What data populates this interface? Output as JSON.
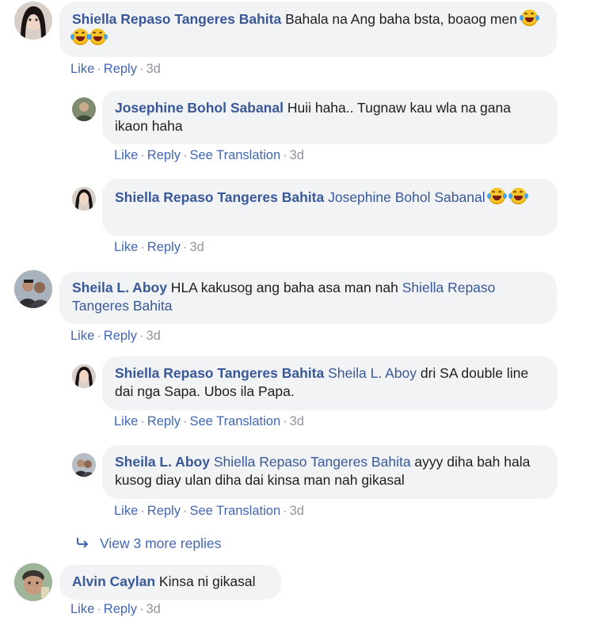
{
  "comments": [
    {
      "author": "Shiella Repaso Tangeres Bahita",
      "text": " Bahala na Ang baha bsta, boaog men",
      "emoji_count": 3,
      "actions": {
        "like": "Like",
        "reply": "Reply",
        "time": "3d"
      }
    },
    {
      "author": "Josephine Bohol Sabanal",
      "text": " Huii haha.. Tugnaw kau wla na gana ikaon haha",
      "actions": {
        "like": "Like",
        "reply": "Reply",
        "translate": "See Translation",
        "time": "3d"
      }
    },
    {
      "author": "Shiella Repaso Tangeres Bahita",
      "mention": "Josephine Bohol Sabanal",
      "emoji_count": 2,
      "actions": {
        "like": "Like",
        "reply": "Reply",
        "time": "3d"
      }
    },
    {
      "author": "Sheila L. Aboy",
      "text": " HLA kakusog ang baha asa man nah ",
      "mention": "Shiella Repaso Tangeres Bahita",
      "actions": {
        "like": "Like",
        "reply": "Reply",
        "time": "3d"
      }
    },
    {
      "author": "Shiella Repaso Tangeres Bahita",
      "mention": "Sheila L. Aboy",
      "text": " dri SA double line dai nga Sapa. Ubos ila Papa.",
      "actions": {
        "like": "Like",
        "reply": "Reply",
        "translate": "See Translation",
        "time": "3d"
      }
    },
    {
      "author": "Sheila L. Aboy",
      "mention": "Shiella Repaso Tangeres Bahita",
      "text": " ayyy diha bah hala kusog diay ulan diha dai kinsa man nah gikasal",
      "actions": {
        "like": "Like",
        "reply": "Reply",
        "translate": "See Translation",
        "time": "3d"
      }
    },
    {
      "author": "Alvin Caylan",
      "text": " Kinsa ni gikasal",
      "actions": {
        "like": "Like",
        "reply": "Reply",
        "time": "3d"
      }
    }
  ],
  "more_replies": {
    "label": "View 3 more replies",
    "icon": "reply-arrow-icon"
  },
  "colors": {
    "name_link": "#385898",
    "action_link": "#4267b2",
    "bubble": "#f2f3f5",
    "meta": "#90949c"
  }
}
